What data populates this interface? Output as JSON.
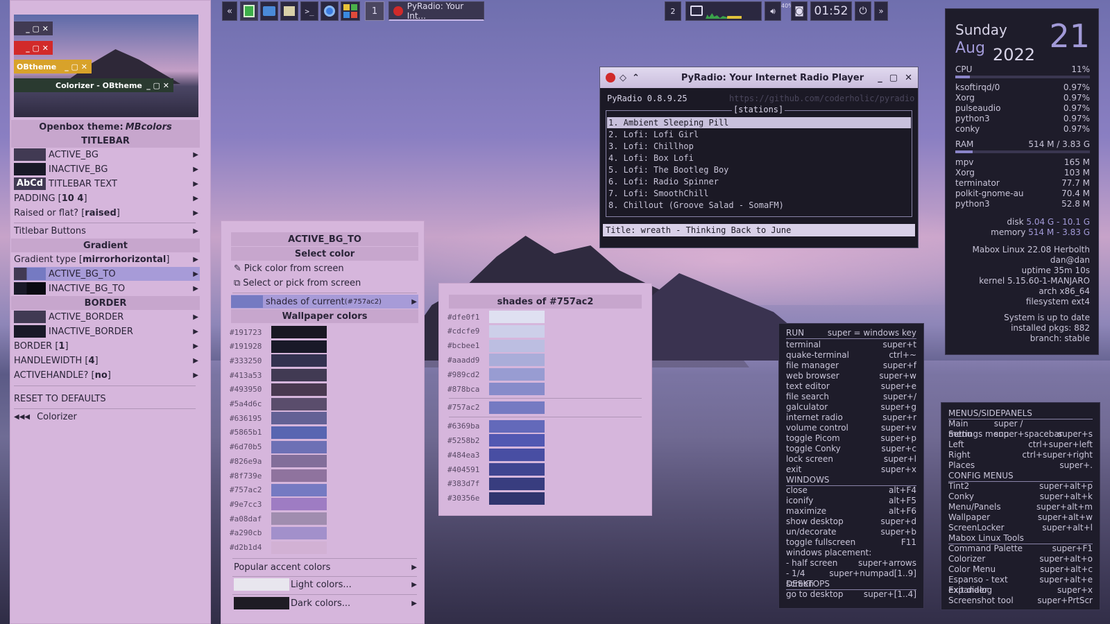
{
  "taskbar": {
    "workspace": "1",
    "task_title": "PyRadio: Your Int...",
    "left_arrows": "«",
    "right_arrows": "»",
    "pager": "2",
    "clock": "01:52",
    "cpu_pct": "40%"
  },
  "left_menu": {
    "mini_windows": [
      {
        "label": "OBtheme"
      },
      {
        "label": "Colorizer - OBtheme"
      }
    ],
    "theme_title_prefix": "Openbox theme: ",
    "theme_name": "MBcolors",
    "titlebar_header": "TITLEBAR",
    "items": [
      {
        "label": "ACTIVE_BG",
        "swatch": "#413a53"
      },
      {
        "label": "INACTIVE_BG",
        "swatch": "#191928"
      },
      {
        "label": "TITLEBAR TEXT",
        "swatch_text": "AbCd"
      },
      {
        "label": "PADDING [ ",
        "bold": "10 4",
        "end": " ]"
      },
      {
        "label": "Raised or flat? [ ",
        "bold": "raised",
        "end": " ]"
      }
    ],
    "titlebar_buttons": "Titlebar Buttons",
    "gradient_header": "Gradient",
    "gradient_type_label": "Gradient type [ ",
    "gradient_type_value": "mirrorhorizontal",
    "gradient_type_end": " ]",
    "active_bg_to": "ACTIVE_BG_TO",
    "inactive_bg_to": "INACTIVE_BG_TO",
    "border_header": "BORDER",
    "active_border": "ACTIVE_BORDER",
    "inactive_border": "INACTIVE_BORDER",
    "border_label": "BORDER [ ",
    "border_value": "1",
    "border_end": " ]",
    "handlewidth_label": "HANDLEWIDTH [ ",
    "handlewidth_value": "4",
    "handlewidth_end": " ]",
    "activehandle_label": "ACTIVEHANDLE? [ ",
    "activehandle_value": "no",
    "activehandle_end": " ]",
    "reset": "RESET TO DEFAULTS",
    "back_arrows": "◀◀◀",
    "back_label": "Colorizer"
  },
  "mid_menu": {
    "title": "ACTIVE_BG_TO",
    "select_header": "Select color",
    "pick": "Pick color from screen",
    "select_pick": "Select or pick from screen",
    "shades_label": "shades of current ",
    "shades_hex": "(#757ac2)",
    "wallpaper_header": "Wallpaper colors",
    "colors": [
      "#191723",
      "#191928",
      "#333250",
      "#413a53",
      "#493950",
      "#5a4d6c",
      "#636195",
      "#5865b1",
      "#6d70b5",
      "#826e9a",
      "#8f739e",
      "#757ac2",
      "#9e7cc3",
      "#a08daf",
      "#a290cb",
      "#d2b1d4"
    ],
    "popular": "Popular accent colors",
    "light": "Light colors...",
    "dark": "Dark colors..."
  },
  "shades": {
    "title": "shades of #757ac2",
    "light": [
      "#dfe0f1",
      "#cdcfe9",
      "#bcbee1",
      "#aaadd9",
      "#989cd2",
      "#878bca"
    ],
    "current": "#757ac2",
    "dark": [
      "#6369ba",
      "#5258b2",
      "#484ea3",
      "#404591",
      "#383d7f",
      "#30356e"
    ]
  },
  "pyradio": {
    "title": "PyRadio: Your Internet Radio Player",
    "version": "PyRadio 0.8.9.25",
    "url": "https://github.com/coderholic/pyradio",
    "section": "[stations]",
    "stations": [
      "1. Ambient Sleeping Pill",
      "2. Lofi: Lofi Girl",
      "3. Lofi: Chillhop",
      "4. Lofi: Box Lofi",
      "5. Lofi: The Bootleg Boy",
      "6. Lofi: Radio Spinner",
      "7. Lofi: SmoothChill",
      "8. Chillout (Groove Salad - SomaFM)"
    ],
    "status": "Title: wreath - Thinking Back to June"
  },
  "conky": {
    "day": "Sunday",
    "month": "Aug",
    "date": "21",
    "year": "2022",
    "cpu_label": "CPU",
    "cpu_value": "11%",
    "cpu_fraction": 0.11,
    "cpu_procs": [
      [
        "ksoftirqd/0",
        "0.97%"
      ],
      [
        "Xorg",
        "0.97%"
      ],
      [
        "pulseaudio",
        "0.97%"
      ],
      [
        "python3",
        "0.97%"
      ],
      [
        "conky",
        "0.97%"
      ]
    ],
    "ram_label": "RAM",
    "ram_value": "514 M / 3.83 G",
    "ram_fraction": 0.13,
    "ram_procs": [
      [
        "mpv",
        "165 M"
      ],
      [
        "Xorg",
        "103 M"
      ],
      [
        "terminator",
        "77.7 M"
      ],
      [
        "polkit-gnome-au",
        "70.4 M"
      ],
      [
        "python3",
        "52.8 M"
      ]
    ],
    "disk_label": "disk",
    "disk_value": "5.04 G - 10.1 G",
    "mem_label": "memory",
    "mem_value": "514 M - 3.83 G",
    "info": [
      "Mabox Linux 22.08 Herbolth",
      "dan@dan",
      "uptime 35m 10s",
      "kernel 5.15.60-1-MANJARO",
      "arch x86_64",
      "filesystem ext4"
    ],
    "updates": [
      "System is up to date",
      "installed pkgs: 882",
      "branch: stable"
    ]
  },
  "keys": {
    "run_label": "RUN",
    "run_note": "super = windows key",
    "run": [
      [
        "terminal",
        "super+t"
      ],
      [
        "quake-terminal",
        "ctrl+~"
      ],
      [
        "file manager",
        "super+f"
      ],
      [
        "web browser",
        "super+w"
      ],
      [
        "text editor",
        "super+e"
      ],
      [
        "file search",
        "super+/"
      ],
      [
        "galculator",
        "super+g"
      ],
      [
        "internet radio",
        "super+r"
      ],
      [
        "volume control",
        "super+v"
      ],
      [
        "toggle Picom",
        "super+p"
      ],
      [
        "toggle Conky",
        "super+c"
      ],
      [
        "lock screen",
        "super+l"
      ],
      [
        "exit",
        "super+x"
      ]
    ],
    "windows_label": "WINDOWS",
    "windows": [
      [
        "close",
        "alt+F4"
      ],
      [
        "iconify",
        "alt+F5"
      ],
      [
        "maximize",
        "alt+F6"
      ],
      [
        "show desktop",
        "super+d"
      ],
      [
        "un/decorate",
        "super+b"
      ],
      [
        "toggle fullscreen",
        "F11"
      ],
      [
        "windows placement:",
        ""
      ],
      [
        " - half screen",
        "super+arrows"
      ],
      [
        " - 1/4 screen",
        "super+numpad[1..9]"
      ]
    ],
    "desktops_label": "DESKTOPS",
    "desktops": [
      [
        "go to desktop",
        "super+[1..4]"
      ]
    ]
  },
  "keys2": {
    "menus_label": "MENUS/SIDEPANELS",
    "menus": [
      [
        "Main menu",
        "super / super+spacebar"
      ],
      [
        "Settings menu",
        "super+s"
      ],
      [
        "Left",
        "ctrl+super+left"
      ],
      [
        "Right",
        "ctrl+super+right"
      ],
      [
        "Places",
        "super+."
      ]
    ],
    "config_label": "CONFIG MENUS",
    "config": [
      [
        "Tint2",
        "super+alt+p"
      ],
      [
        "Conky",
        "super+alt+k"
      ],
      [
        "Menu/Panels",
        "super+alt+m"
      ],
      [
        "Wallpaper",
        "super+alt+w"
      ],
      [
        "ScreenLocker",
        "super+alt+l"
      ]
    ],
    "tools_label": "Mabox Linux Tools",
    "tools": [
      [
        "Command Palette",
        "super+F1"
      ],
      [
        "Colorizer",
        "super+alt+o"
      ],
      [
        "Color Menu",
        "super+alt+c"
      ],
      [
        "Espanso - text expander",
        "super+alt+e"
      ],
      [
        "Exit dialog",
        "super+x"
      ],
      [
        "Screenshot tool",
        "super+PrtScr"
      ]
    ]
  }
}
